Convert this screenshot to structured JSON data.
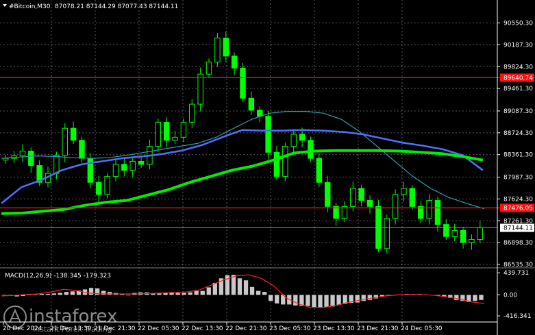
{
  "header": {
    "symbol": "#Bitcoin,M30",
    "ohlc": "87078.21 87144.29 87077.43 87144.11"
  },
  "watermark": {
    "brand": "instaforex",
    "tagline": "Instant Forex Trading"
  },
  "colors": {
    "background": "#000000",
    "candles": "#00ff00",
    "ma_green": "#00ee00",
    "ma_blue": "#4f6fff",
    "ma_teal": "#2f9faf",
    "level_line": "#ff1010",
    "macd_hist": "#c8c8c8",
    "macd_signal": "#ff2020"
  },
  "chart_data": [
    {
      "type": "candlestick",
      "title": "#Bitcoin,M30",
      "ylim": [
        86535.3,
        90750
      ],
      "y_ticks": [
        "90550.30",
        "90187.30",
        "89824.30",
        "89461.30",
        "89087.30",
        "88724.30",
        "88361.30",
        "87987.30",
        "87624.30",
        "87261.30",
        "86898.30",
        "86535.30"
      ],
      "x_ticks": [
        "20 Dec 2024",
        "21 Dec 13:30",
        "21 Dec 21:30",
        "22 Dec 05:30",
        "22 Dec 13:30",
        "22 Dec 21:30",
        "23 Dec 05:30",
        "23 Dec 13:30",
        "23 Dec 21:30",
        "24 Dec 05:30"
      ],
      "current_price": "87144.11",
      "levels": [
        {
          "label": "89640.74",
          "value": 89640.74
        },
        {
          "label": "87476.05",
          "value": 87476.05
        }
      ],
      "close_path": [
        88300,
        88340,
        88420,
        88180,
        87900,
        88050,
        88350,
        88800,
        88600,
        88300,
        87900,
        87700,
        88000,
        88200,
        88100,
        88250,
        88200,
        88500,
        88900,
        88600,
        88650,
        88900,
        89200,
        89700,
        89900,
        90300,
        90000,
        89800,
        89300,
        89100,
        89000,
        88400,
        88000,
        88500,
        88700,
        88600,
        88300,
        87900,
        87500,
        87300,
        87500,
        87800,
        87600,
        87500,
        86800,
        87300,
        87700,
        87800,
        87500,
        87300,
        87600,
        87200,
        87000,
        87100,
        86900,
        86950,
        87144
      ],
      "series": [
        {
          "name": "",
          "color": "#2f9faf",
          "values": [
            88300,
            88320,
            88340,
            88330,
            88310,
            88300,
            88310,
            88350,
            88400,
            88450,
            88500,
            88550,
            88650,
            88800,
            88950,
            89050,
            89080,
            89080,
            89050,
            88950,
            88750,
            88500,
            88250,
            88000,
            87800,
            87650,
            87550,
            87460
          ]
        },
        {
          "name": "",
          "color": "#4f6fff",
          "values": [
            87550,
            87820,
            87940,
            88100,
            88200,
            88250,
            88300,
            88330,
            88370,
            88430,
            88520,
            88650,
            88770,
            88760,
            88760,
            88770,
            88760,
            88740,
            88700,
            88630,
            88560,
            88510,
            88450,
            88350,
            88100
          ]
        },
        {
          "name": "",
          "color": "#00ee00",
          "values": [
            87380,
            87390,
            87420,
            87450,
            87520,
            87570,
            87600,
            87690,
            87780,
            87900,
            88000,
            88100,
            88170,
            88270,
            88390,
            88420,
            88430,
            88430,
            88430,
            88420,
            88400,
            88380,
            88330,
            88270
          ]
        }
      ]
    },
    {
      "type": "bar",
      "title": "MACD(12,26,9) -138.345 -179.323",
      "ylim": [
        -470,
        470
      ],
      "y_ticks": [
        "439.731",
        "0.00",
        "-416.341"
      ],
      "histogram": [
        -10,
        -20,
        -30,
        -20,
        0,
        10,
        20,
        20,
        30,
        40,
        60,
        70,
        90,
        110,
        140,
        130,
        80,
        60,
        40,
        20,
        -10,
        40,
        50,
        50,
        30,
        30,
        40,
        40,
        40,
        40,
        50,
        80,
        80,
        150,
        240,
        330,
        390,
        400,
        330,
        290,
        160,
        80,
        60,
        -120,
        -170,
        -190,
        -190,
        -210,
        -220,
        -220,
        -240,
        -250,
        -240,
        -230,
        -200,
        -180,
        -160,
        -150,
        -120,
        -100,
        -70,
        -40,
        -20,
        -10,
        10,
        20,
        20,
        20,
        10,
        0,
        -20,
        -40,
        -60,
        -100,
        -120,
        -140,
        -120,
        -100
      ],
      "signal": [
        -20,
        -10,
        10,
        20,
        60,
        110,
        90,
        40,
        20,
        20,
        20,
        20,
        30,
        40,
        50,
        60,
        100,
        200,
        300,
        380,
        400,
        330,
        180,
        -60,
        -180,
        -250,
        -250,
        -210,
        -150,
        -100,
        -60,
        -20,
        0,
        10,
        10,
        -10,
        -40,
        -80,
        -140,
        -170
      ]
    }
  ]
}
